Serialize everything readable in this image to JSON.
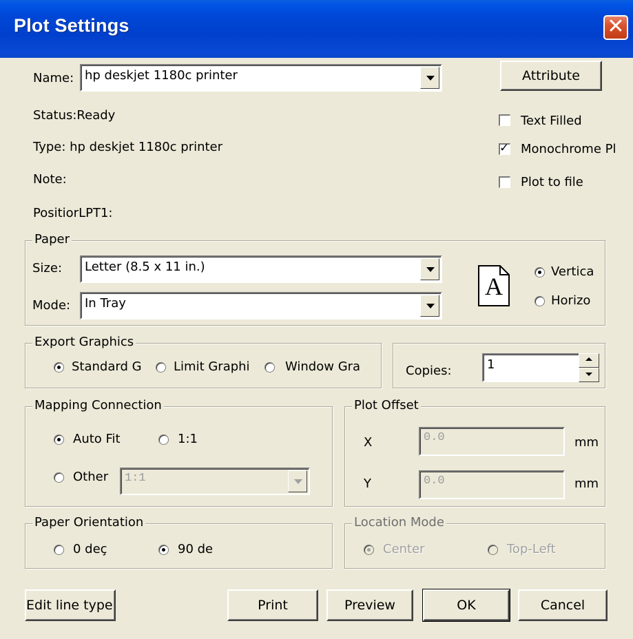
{
  "window": {
    "title": "Plot Settings",
    "close_glyph": "✕"
  },
  "printer": {
    "name_label": "Name:",
    "name_value": "hp deskjet 1180c printer",
    "status": "Status:Ready",
    "type": "Type:  hp deskjet 1180c printer",
    "note": "Note:",
    "position": "PositiorLPT1:"
  },
  "attribute_button": "Attribute",
  "options": {
    "text_filled": {
      "label": "Text Filled",
      "checked": false
    },
    "monochrome": {
      "label": "Monochrome Pl",
      "checked": true
    },
    "plot_to_file": {
      "label": "Plot to file",
      "checked": false
    }
  },
  "paper": {
    "group_label": "Paper",
    "size_label": "Size:",
    "size_value": "Letter (8.5 x 11 in.)",
    "mode_label": "Mode:",
    "mode_value": "In Tray",
    "preview_letter": "A",
    "orientation_vertical": "Vertica",
    "orientation_horizontal": "Horizo"
  },
  "export_graphics": {
    "group_label": "Export Graphics",
    "options": [
      "Standard G",
      "Limit Graphi",
      "Window Gra"
    ]
  },
  "copies": {
    "label": "Copies:",
    "value": "1"
  },
  "mapping": {
    "group_label": "Mapping Connection",
    "auto_fit": "Auto Fit",
    "one_to_one": "1:1",
    "other": "Other",
    "other_value": "1:1"
  },
  "plot_offset": {
    "group_label": "Plot Offset",
    "x_label": "X",
    "y_label": "Y",
    "x_value": "0.0",
    "y_value": "0.0",
    "unit": "mm"
  },
  "paper_orientation": {
    "group_label": "Paper Orientation",
    "deg0": "0 deç",
    "deg90": "90 de"
  },
  "location_mode": {
    "group_label": "Location Mode",
    "center": "Center",
    "top_left": "Top-Left"
  },
  "buttons": {
    "edit_line_type": "Edit line type",
    "print": "Print",
    "preview": "Preview",
    "ok": "OK",
    "cancel": "Cancel"
  },
  "colors": {
    "titlebar": "#0046d6",
    "dialog_bg": "#ece9d8",
    "close": "#d9532e"
  },
  "icons": {
    "close": "close-icon",
    "dropdown": "chevron-down-icon",
    "paper_preview": "paper-portrait-icon"
  }
}
